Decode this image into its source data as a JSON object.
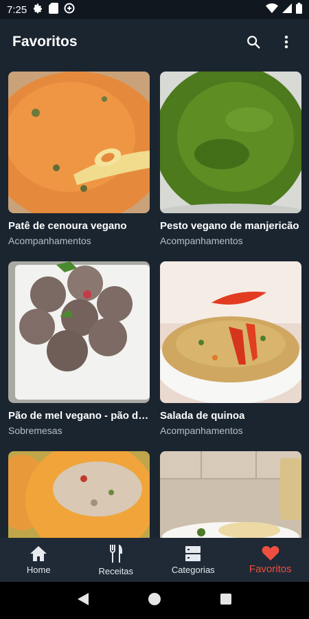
{
  "status_bar": {
    "time": "7:25"
  },
  "app_bar": {
    "title": "Favoritos"
  },
  "recipes": [
    {
      "title": "Patê de cenoura vegano",
      "category": "Acompanhamentos"
    },
    {
      "title": "Pesto vegano de manjericão",
      "category": "Acompanhamentos"
    },
    {
      "title": "Pão de mel vegano - pão de mel",
      "category": "Sobremesas"
    },
    {
      "title": "Salada de quinoa",
      "category": "Acompanhamentos"
    },
    {
      "title": "",
      "category": ""
    },
    {
      "title": "",
      "category": ""
    }
  ],
  "bottom_nav": {
    "items": [
      {
        "label": "Home",
        "icon": "home-icon"
      },
      {
        "label": "Receitas",
        "icon": "cutlery-icon"
      },
      {
        "label": "Categorias",
        "icon": "categories-icon"
      },
      {
        "label": "Favoritos",
        "icon": "heart-icon"
      }
    ],
    "active": "Favoritos",
    "active_color": "#ef4f40"
  },
  "colors": {
    "background": "#1b2530",
    "nav_background": "#1f2a36",
    "accent": "#ef4f40"
  }
}
